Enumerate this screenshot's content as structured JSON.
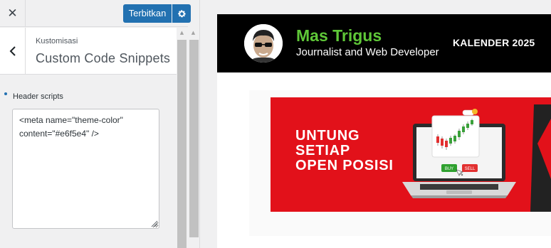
{
  "customizer": {
    "close_icon": "close-icon",
    "publish_label": "Terbitkan",
    "settings_icon": "gear-icon",
    "back_icon": "chevron-left-icon",
    "breadcrumb": "Kustomisasi",
    "section_title": "Custom Code Snippets",
    "control": {
      "label": "Header scripts",
      "value": "<meta name=\"theme-color\" content=\"#e6f5e4\" />"
    },
    "accent_color": "#2271b1"
  },
  "preview": {
    "site_name": "Mas Trigus",
    "tagline": "Journalist and Web Developer",
    "nav_item": "KALENDER 2025",
    "header_bg": "#000000",
    "site_name_color": "#5fc738",
    "banner": {
      "headline": [
        "UNTUNG",
        "SETIAP",
        "OPEN POSISI"
      ],
      "bg_color": "#e2111a",
      "buy_label": "BUY",
      "sell_label": "SELL"
    }
  }
}
